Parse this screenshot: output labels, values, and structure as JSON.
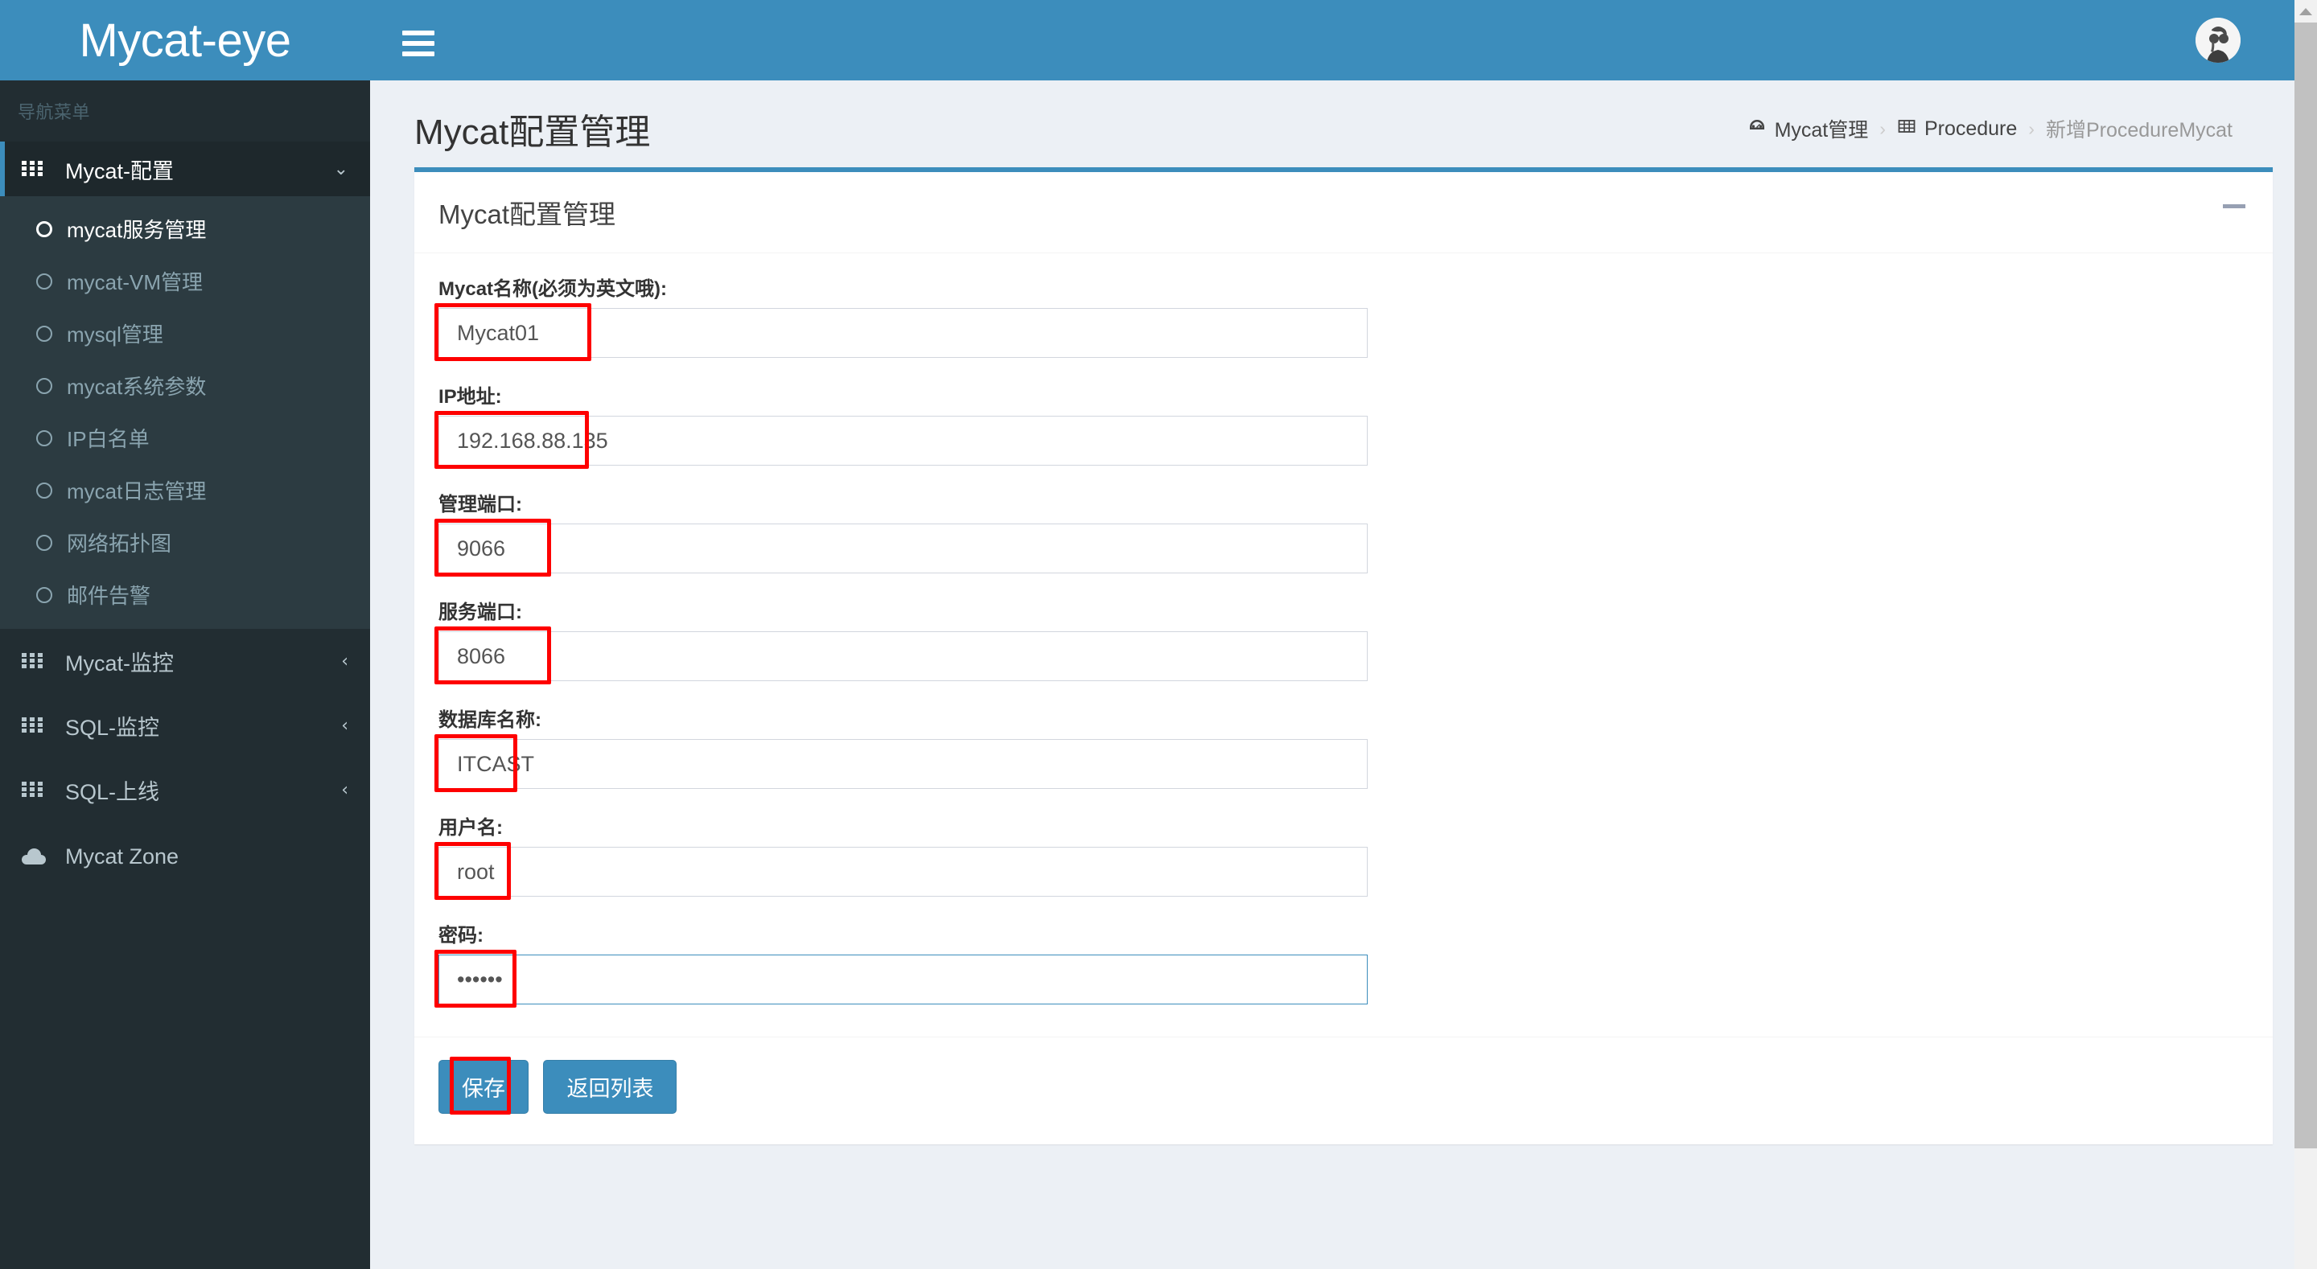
{
  "brand": {
    "name": "Mycat-eye"
  },
  "topbar": {
    "menu_toggle_icon": "hamburger-icon",
    "avatar_icon": "user-avatar"
  },
  "sidebar": {
    "nav_header": "导航菜单",
    "groups": [
      {
        "label": "Mycat-配置",
        "icon": "grid-icon",
        "arrow": "⌄",
        "expanded": true,
        "active": true,
        "items": [
          {
            "label": "mycat服务管理",
            "icon": "circle-icon",
            "active": true
          },
          {
            "label": "mycat-VM管理",
            "icon": "circle-icon",
            "active": false
          },
          {
            "label": "mysql管理",
            "icon": "circle-icon",
            "active": false
          },
          {
            "label": "mycat系统参数",
            "icon": "circle-icon",
            "active": false
          },
          {
            "label": "IP白名单",
            "icon": "circle-icon",
            "active": false
          },
          {
            "label": "mycat日志管理",
            "icon": "circle-icon",
            "active": false
          },
          {
            "label": "网络拓扑图",
            "icon": "circle-icon",
            "active": false
          },
          {
            "label": "邮件告警",
            "icon": "circle-icon",
            "active": false
          }
        ]
      },
      {
        "label": "Mycat-监控",
        "icon": "grid-icon",
        "arrow": "‹",
        "expanded": false,
        "active": false,
        "items": []
      },
      {
        "label": "SQL-监控",
        "icon": "grid-icon",
        "arrow": "‹",
        "expanded": false,
        "active": false,
        "items": []
      },
      {
        "label": "SQL-上线",
        "icon": "grid-icon",
        "arrow": "‹",
        "expanded": false,
        "active": false,
        "items": []
      }
    ],
    "footer_item": {
      "label": "Mycat Zone",
      "icon": "cloud-icon"
    }
  },
  "page": {
    "title": "Mycat配置管理",
    "breadcrumb": [
      {
        "label": "Mycat管理",
        "icon": "dashboard-icon",
        "muted": false
      },
      {
        "label": "Procedure",
        "icon": "table-icon",
        "muted": false
      },
      {
        "label": "新增ProcedureMycat",
        "icon": "",
        "muted": true
      }
    ],
    "breadcrumb_separator": "›"
  },
  "box": {
    "title": "Mycat配置管理",
    "collapse_icon": "minus-icon"
  },
  "form": {
    "fields": [
      {
        "label": "Mycat名称(必须为英文哦):",
        "value": "Mycat01",
        "name": "mycat-name",
        "type": "text",
        "focused": false,
        "annot_width": 185
      },
      {
        "label": "IP地址:",
        "value": "192.168.88.135",
        "name": "ip-address",
        "type": "text",
        "focused": false,
        "annot_width": 182
      },
      {
        "label": "管理端口:",
        "value": "9066",
        "name": "manage-port",
        "type": "text",
        "focused": false,
        "annot_width": 135
      },
      {
        "label": "服务端口:",
        "value": "8066",
        "name": "service-port",
        "type": "text",
        "focused": false,
        "annot_width": 135
      },
      {
        "label": "数据库名称:",
        "value": "ITCAST",
        "name": "database-name",
        "type": "text",
        "focused": false,
        "annot_width": 93
      },
      {
        "label": "用户名:",
        "value": "root",
        "name": "username",
        "type": "text",
        "focused": false,
        "annot_width": 85
      },
      {
        "label": "密码:",
        "value": "••••••",
        "name": "password",
        "type": "password",
        "focused": true,
        "annot_width": 92
      }
    ]
  },
  "footer": {
    "save_label": "保存",
    "back_label": "返回列表"
  },
  "colors": {
    "brand_blue": "#3c8dbc",
    "sidebar_dark": "#222d32",
    "submenu_dark": "#2c3b41",
    "content_bg": "#ecf0f5",
    "annotation_red": "#fe0000"
  }
}
